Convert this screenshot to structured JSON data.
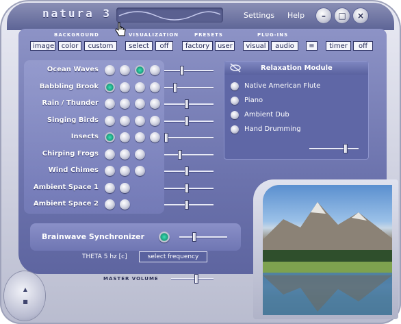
{
  "app": {
    "logo": "natura 3"
  },
  "menu": {
    "settings": "Settings",
    "help": "Help"
  },
  "window_controls": {
    "minimize": "–",
    "maximize": "□",
    "close": "×"
  },
  "groups": {
    "background": {
      "label": "BACKGROUND",
      "buttons": [
        "image",
        "color",
        "custom"
      ]
    },
    "visualization": {
      "label": "VISUALIZATION",
      "buttons": [
        "select",
        "off"
      ]
    },
    "presets": {
      "label": "PRESETS",
      "buttons": [
        "factory",
        "user"
      ]
    },
    "plugins": {
      "label": "PLUG-INS",
      "buttons": [
        "visual",
        "audio"
      ]
    },
    "timer": {
      "buttons": [
        "timer",
        "off"
      ]
    }
  },
  "sounds": [
    {
      "label": "Ocean Waves",
      "selected": 3,
      "count": 4,
      "volume": 0.35
    },
    {
      "label": "Babbling Brook",
      "selected": 1,
      "count": 4,
      "volume": 0.2
    },
    {
      "label": "Rain / Thunder",
      "selected": 0,
      "count": 4,
      "volume": 0.45
    },
    {
      "label": "Singing Birds",
      "selected": 0,
      "count": 4,
      "volume": 0.45
    },
    {
      "label": "Insects",
      "selected": 1,
      "count": 4,
      "volume": 0.0
    },
    {
      "label": "Chirping Frogs",
      "selected": 0,
      "count": 3,
      "volume": 0.3
    },
    {
      "label": "Wind Chimes",
      "selected": 0,
      "count": 3,
      "volume": 0.45
    },
    {
      "label": "Ambient Space 1",
      "selected": 0,
      "count": 2,
      "volume": 0.45
    },
    {
      "label": "Ambient Space 2",
      "selected": 0,
      "count": 2,
      "volume": 0.45
    }
  ],
  "relaxation": {
    "title": "Relaxation Module",
    "items": [
      "Native American Flute",
      "Piano",
      "Ambient Dub",
      "Hand Drumming"
    ],
    "volume": 0.75
  },
  "brainwave": {
    "title": "Brainwave Synchronizer",
    "status": "THETA 5 hz [c]",
    "select_label": "select frequency",
    "enabled": true,
    "level": 0.3
  },
  "master": {
    "label": "MASTER VOLUME",
    "volume": 0.6
  }
}
